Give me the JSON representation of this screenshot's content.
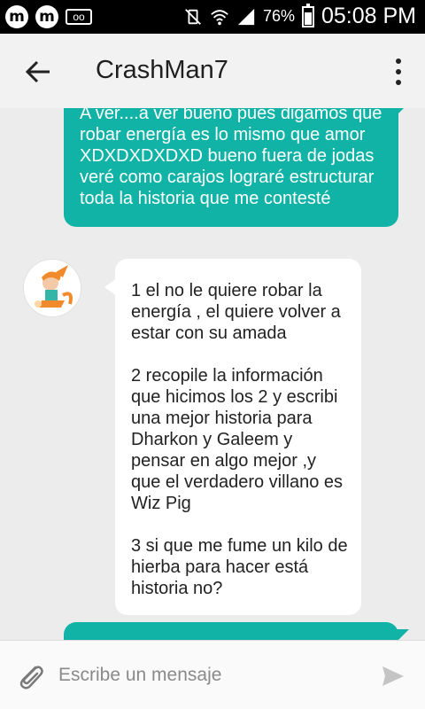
{
  "status_bar": {
    "app_icon_1": "m",
    "app_icon_2": "m",
    "voicemail_icon": "oo",
    "battery_pct": "76%",
    "battery_level": 0.76,
    "time": "05:08 PM"
  },
  "header": {
    "title": "CrashMan7"
  },
  "messages": [
    {
      "direction": "outgoing",
      "text": "A ver....a ver bueno pues digamos que robar energía es lo mismo que amor XDXDXDXDXD bueno fuera de jodas veré como carajos lograré estructurar toda la historia que me contesté"
    },
    {
      "direction": "incoming",
      "paragraphs": [
        "1 el no le quiere robar la energía , el quiere volver a estar con su amada",
        "2 recopile la  información que hicimos los 2 y escribi una mejor historia para Dharkon y Galeem y pensar en algo mejor ,y que el verdadero villano es Wiz Pig",
        "3 si que me fume un kilo de hierba para hacer está historia no?"
      ]
    }
  ],
  "composer": {
    "placeholder": "Escribe un mensaje"
  },
  "colors": {
    "accent": "#11b3a6",
    "background": "#ececec"
  }
}
